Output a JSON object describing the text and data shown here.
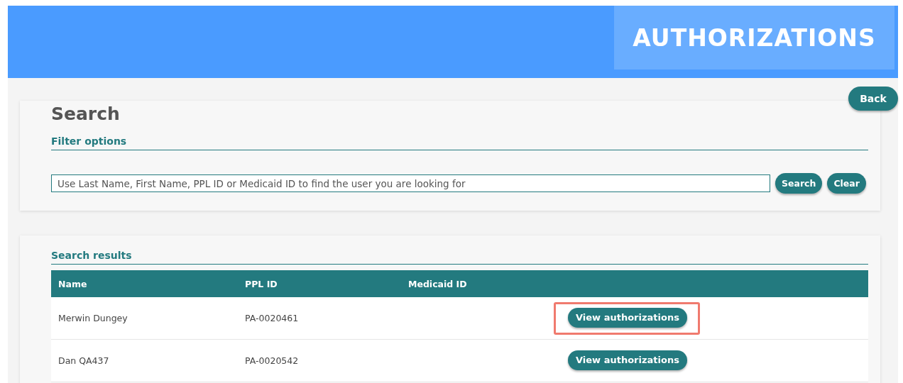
{
  "header": {
    "title": "AUTHORIZATIONS"
  },
  "back_button": "Back",
  "search": {
    "heading": "Search",
    "section": "Filter options",
    "placeholder": "Use Last Name, First Name, PPL ID or Medicaid ID to find the user you are looking for",
    "buttons": [
      "Search",
      "Clear"
    ]
  },
  "results": {
    "section": "Search results",
    "columns": [
      "Name",
      "PPL ID",
      "Medicaid ID"
    ],
    "rows": [
      {
        "name": "Merwin Dungey",
        "ppl_id": "PA-0020461",
        "action": "View authorizations",
        "highlighted": true
      },
      {
        "name": "Dan QA437",
        "ppl_id": "PA-0020542",
        "action": "View authorizations",
        "highlighted": false
      }
    ]
  }
}
